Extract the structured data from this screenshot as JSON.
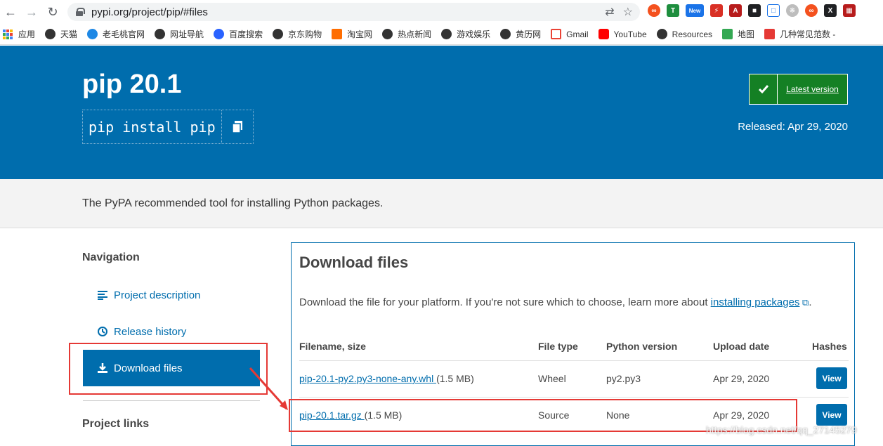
{
  "browser": {
    "url": "pypi.org/project/pip/#files",
    "bookmarks": [
      "应用",
      "天猫",
      "老毛桃官网",
      "网址导航",
      "百度搜索",
      "京东购物",
      "淘宝网",
      "热点新闻",
      "游戏娱乐",
      "黄历网",
      "Gmail",
      "YouTube",
      "Resources",
      "地图",
      "几种常见范数 -"
    ],
    "new_badge": "New"
  },
  "header": {
    "title": "pip 20.1",
    "install_cmd": "pip install pip",
    "latest_label": "Latest version",
    "released": "Released: Apr 29, 2020"
  },
  "summary": "The PyPA recommended tool for installing Python packages.",
  "sidebar": {
    "heading": "Navigation",
    "items": [
      "Project description",
      "Release history",
      "Download files"
    ],
    "project_links": "Project links"
  },
  "downloads": {
    "title": "Download files",
    "desc_prefix": "Download the file for your platform. If you're not sure which to choose, learn more about ",
    "desc_link": "installing packages",
    "desc_suffix": ".",
    "headers": [
      "Filename, size",
      "File type",
      "Python version",
      "Upload date",
      "Hashes"
    ],
    "rows": [
      {
        "file": "pip-20.1-py2.py3-none-any.whl ",
        "size": "(1.5 MB)",
        "type": "Wheel",
        "py": "py2.py3",
        "date": "Apr 29, 2020",
        "hash": "View"
      },
      {
        "file": "pip-20.1.tar.gz ",
        "size": "(1.5 MB)",
        "type": "Source",
        "py": "None",
        "date": "Apr 29, 2020",
        "hash": "View"
      }
    ]
  },
  "watermark": "https://blog.csdn.net/qq_27145279",
  "colors": {
    "pypi_blue": "#006dad",
    "green": "#148024",
    "annotation_red": "#e53935"
  }
}
